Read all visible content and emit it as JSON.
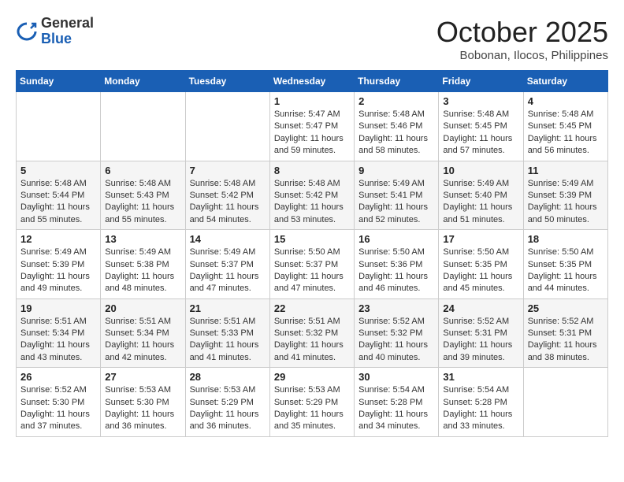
{
  "header": {
    "logo_general": "General",
    "logo_blue": "Blue",
    "month": "October 2025",
    "location": "Bobonan, Ilocos, Philippines"
  },
  "weekdays": [
    "Sunday",
    "Monday",
    "Tuesday",
    "Wednesday",
    "Thursday",
    "Friday",
    "Saturday"
  ],
  "weeks": [
    [
      {
        "day": "",
        "info": ""
      },
      {
        "day": "",
        "info": ""
      },
      {
        "day": "",
        "info": ""
      },
      {
        "day": "1",
        "info": "Sunrise: 5:47 AM\nSunset: 5:47 PM\nDaylight: 11 hours\nand 59 minutes."
      },
      {
        "day": "2",
        "info": "Sunrise: 5:48 AM\nSunset: 5:46 PM\nDaylight: 11 hours\nand 58 minutes."
      },
      {
        "day": "3",
        "info": "Sunrise: 5:48 AM\nSunset: 5:45 PM\nDaylight: 11 hours\nand 57 minutes."
      },
      {
        "day": "4",
        "info": "Sunrise: 5:48 AM\nSunset: 5:45 PM\nDaylight: 11 hours\nand 56 minutes."
      }
    ],
    [
      {
        "day": "5",
        "info": "Sunrise: 5:48 AM\nSunset: 5:44 PM\nDaylight: 11 hours\nand 55 minutes."
      },
      {
        "day": "6",
        "info": "Sunrise: 5:48 AM\nSunset: 5:43 PM\nDaylight: 11 hours\nand 55 minutes."
      },
      {
        "day": "7",
        "info": "Sunrise: 5:48 AM\nSunset: 5:42 PM\nDaylight: 11 hours\nand 54 minutes."
      },
      {
        "day": "8",
        "info": "Sunrise: 5:48 AM\nSunset: 5:42 PM\nDaylight: 11 hours\nand 53 minutes."
      },
      {
        "day": "9",
        "info": "Sunrise: 5:49 AM\nSunset: 5:41 PM\nDaylight: 11 hours\nand 52 minutes."
      },
      {
        "day": "10",
        "info": "Sunrise: 5:49 AM\nSunset: 5:40 PM\nDaylight: 11 hours\nand 51 minutes."
      },
      {
        "day": "11",
        "info": "Sunrise: 5:49 AM\nSunset: 5:39 PM\nDaylight: 11 hours\nand 50 minutes."
      }
    ],
    [
      {
        "day": "12",
        "info": "Sunrise: 5:49 AM\nSunset: 5:39 PM\nDaylight: 11 hours\nand 49 minutes."
      },
      {
        "day": "13",
        "info": "Sunrise: 5:49 AM\nSunset: 5:38 PM\nDaylight: 11 hours\nand 48 minutes."
      },
      {
        "day": "14",
        "info": "Sunrise: 5:49 AM\nSunset: 5:37 PM\nDaylight: 11 hours\nand 47 minutes."
      },
      {
        "day": "15",
        "info": "Sunrise: 5:50 AM\nSunset: 5:37 PM\nDaylight: 11 hours\nand 47 minutes."
      },
      {
        "day": "16",
        "info": "Sunrise: 5:50 AM\nSunset: 5:36 PM\nDaylight: 11 hours\nand 46 minutes."
      },
      {
        "day": "17",
        "info": "Sunrise: 5:50 AM\nSunset: 5:35 PM\nDaylight: 11 hours\nand 45 minutes."
      },
      {
        "day": "18",
        "info": "Sunrise: 5:50 AM\nSunset: 5:35 PM\nDaylight: 11 hours\nand 44 minutes."
      }
    ],
    [
      {
        "day": "19",
        "info": "Sunrise: 5:51 AM\nSunset: 5:34 PM\nDaylight: 11 hours\nand 43 minutes."
      },
      {
        "day": "20",
        "info": "Sunrise: 5:51 AM\nSunset: 5:34 PM\nDaylight: 11 hours\nand 42 minutes."
      },
      {
        "day": "21",
        "info": "Sunrise: 5:51 AM\nSunset: 5:33 PM\nDaylight: 11 hours\nand 41 minutes."
      },
      {
        "day": "22",
        "info": "Sunrise: 5:51 AM\nSunset: 5:32 PM\nDaylight: 11 hours\nand 41 minutes."
      },
      {
        "day": "23",
        "info": "Sunrise: 5:52 AM\nSunset: 5:32 PM\nDaylight: 11 hours\nand 40 minutes."
      },
      {
        "day": "24",
        "info": "Sunrise: 5:52 AM\nSunset: 5:31 PM\nDaylight: 11 hours\nand 39 minutes."
      },
      {
        "day": "25",
        "info": "Sunrise: 5:52 AM\nSunset: 5:31 PM\nDaylight: 11 hours\nand 38 minutes."
      }
    ],
    [
      {
        "day": "26",
        "info": "Sunrise: 5:52 AM\nSunset: 5:30 PM\nDaylight: 11 hours\nand 37 minutes."
      },
      {
        "day": "27",
        "info": "Sunrise: 5:53 AM\nSunset: 5:30 PM\nDaylight: 11 hours\nand 36 minutes."
      },
      {
        "day": "28",
        "info": "Sunrise: 5:53 AM\nSunset: 5:29 PM\nDaylight: 11 hours\nand 36 minutes."
      },
      {
        "day": "29",
        "info": "Sunrise: 5:53 AM\nSunset: 5:29 PM\nDaylight: 11 hours\nand 35 minutes."
      },
      {
        "day": "30",
        "info": "Sunrise: 5:54 AM\nSunset: 5:28 PM\nDaylight: 11 hours\nand 34 minutes."
      },
      {
        "day": "31",
        "info": "Sunrise: 5:54 AM\nSunset: 5:28 PM\nDaylight: 11 hours\nand 33 minutes."
      },
      {
        "day": "",
        "info": ""
      }
    ]
  ]
}
